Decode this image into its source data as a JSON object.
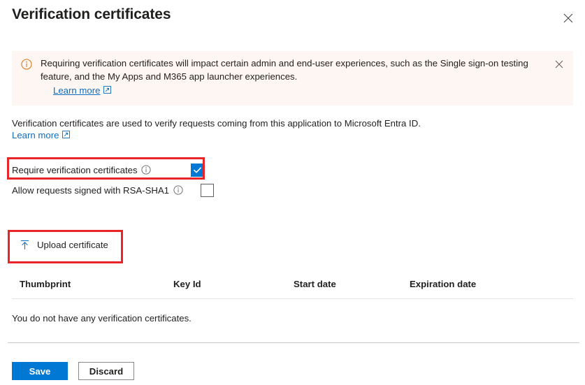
{
  "header": {
    "title": "Verification certificates",
    "close_icon": "close-icon"
  },
  "banner": {
    "icon": "info-circle-icon",
    "text": "Requiring verification certificates will impact certain admin and end-user experiences, such as the Single sign-on testing feature, and the My Apps and M365 app launcher experiences.",
    "link_label": "Learn more",
    "link_icon": "external-link-icon",
    "close_icon": "close-icon",
    "background_color": "#fdf6f3",
    "icon_color": "#d87c22"
  },
  "description": {
    "text": "Verification certificates are used to verify requests coming from this application to Microsoft Entra ID.",
    "link_label": "Learn more",
    "link_icon": "external-link-icon",
    "link_color": "#0f6cbd"
  },
  "options": [
    {
      "label": "Require verification certificates",
      "info_icon": "info-circle-icon",
      "checked": true,
      "highlighted": true
    },
    {
      "label": "Allow requests signed with RSA-SHA1",
      "info_icon": "info-circle-icon",
      "checked": false,
      "highlighted": false
    }
  ],
  "upload": {
    "label": "Upload certificate",
    "icon": "upload-arrow-icon",
    "icon_color": "#0f6cbd",
    "highlighted": true
  },
  "table": {
    "columns": [
      "Thumbprint",
      "Key Id",
      "Start date",
      "Expiration date"
    ],
    "rows": [],
    "empty_message": "You do not have any verification certificates."
  },
  "footer": {
    "save_label": "Save",
    "discard_label": "Discard",
    "primary_color": "#0078d4"
  },
  "annotations": {
    "highlight_color": "#e8262a"
  }
}
